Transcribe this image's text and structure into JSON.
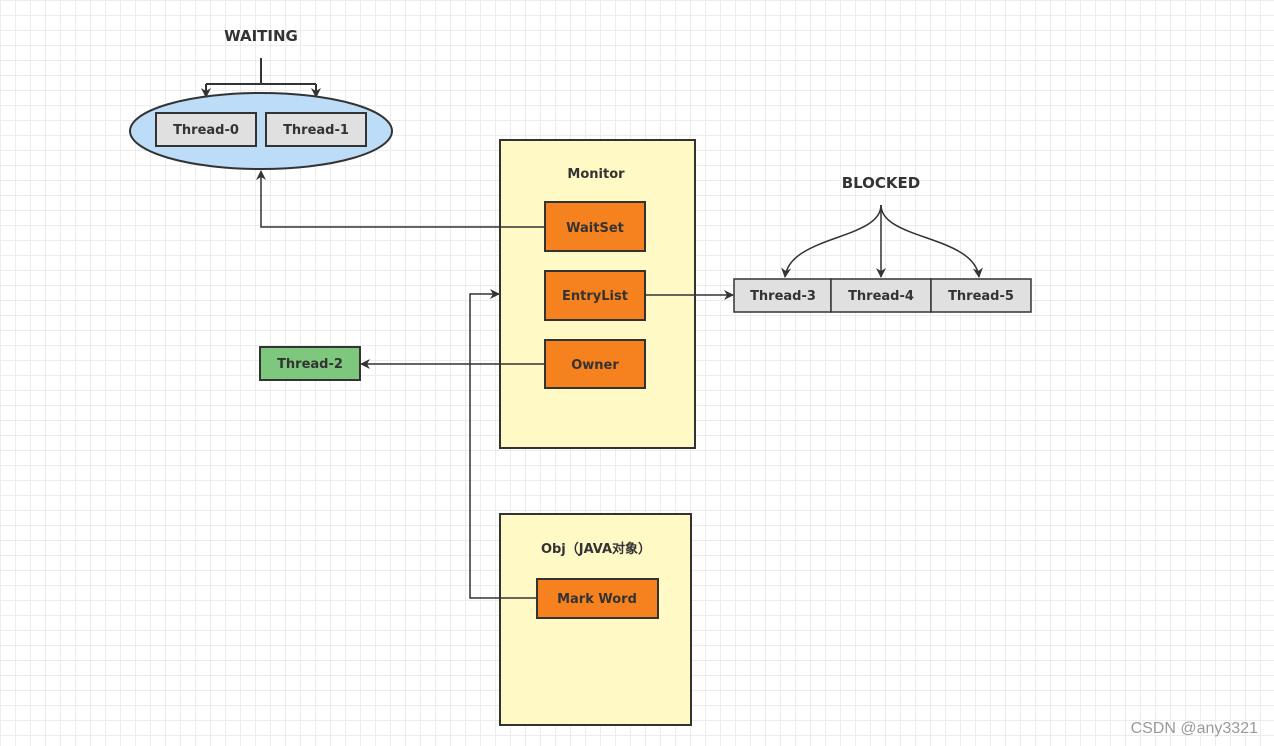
{
  "waiting": {
    "label": "WAITING",
    "threads": [
      "Thread-0",
      "Thread-1"
    ]
  },
  "monitor": {
    "label": "Monitor",
    "fields": [
      "WaitSet",
      "EntryList",
      "Owner"
    ]
  },
  "blocked": {
    "label": "BLOCKED",
    "threads": [
      "Thread-3",
      "Thread-4",
      "Thread-5"
    ]
  },
  "owner_thread": "Thread-2",
  "obj": {
    "label": "Obj（JAVA对象）",
    "field": "Mark Word"
  },
  "watermark": "CSDN @any3321",
  "colors": {
    "orange": "#f5821f",
    "yellow": "#fff9c6",
    "blue": "#bcdcf8",
    "green": "#7ec87e",
    "gray": "#e0e0e0"
  }
}
